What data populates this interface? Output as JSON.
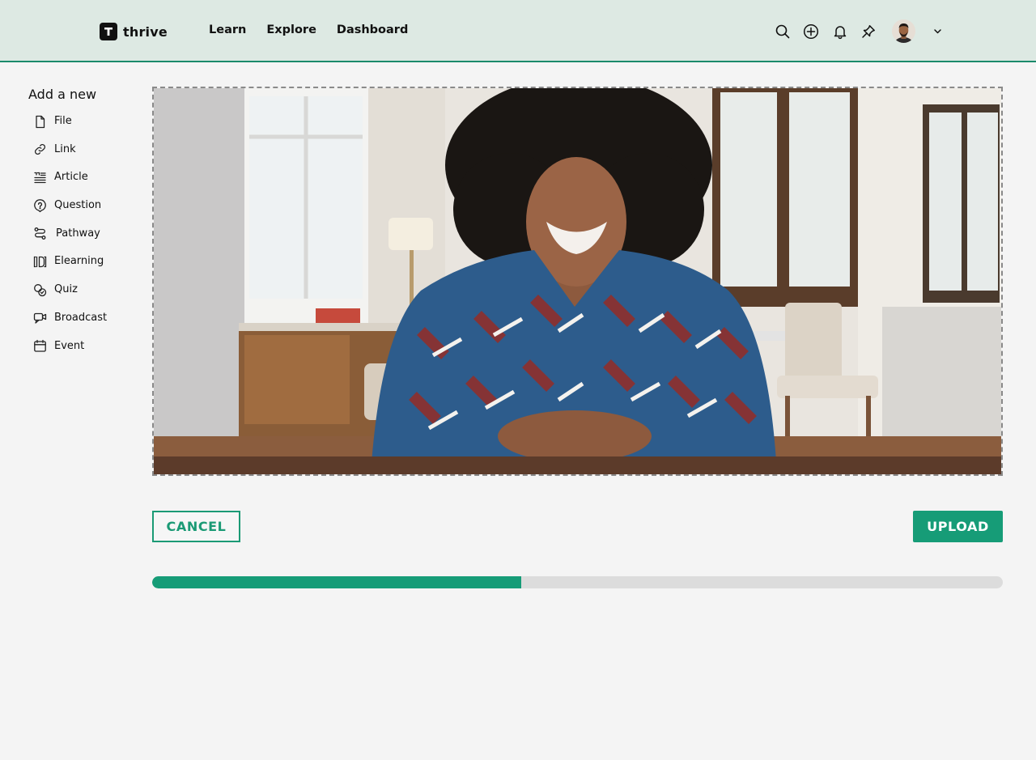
{
  "header": {
    "brand": "thrive",
    "nav": [
      "Learn",
      "Explore",
      "Dashboard"
    ],
    "icons": [
      "search-icon",
      "add-circle-icon",
      "bell-icon",
      "pin-icon",
      "chevron-down-icon"
    ],
    "accent": "#1b8a6b",
    "background": "#dde9e3"
  },
  "sidebar": {
    "title": "Add a new",
    "items": [
      {
        "label": "File",
        "icon": "file-icon"
      },
      {
        "label": "Link",
        "icon": "link-icon"
      },
      {
        "label": "Article",
        "icon": "article-icon"
      },
      {
        "label": "Question",
        "icon": "question-icon"
      },
      {
        "label": "Pathway",
        "icon": "pathway-icon"
      },
      {
        "label": "Elearning",
        "icon": "elearning-icon"
      },
      {
        "label": "Quiz",
        "icon": "quiz-icon"
      },
      {
        "label": "Broadcast",
        "icon": "broadcast-icon"
      },
      {
        "label": "Event",
        "icon": "calendar-icon"
      }
    ]
  },
  "actions": {
    "cancel_label": "CANCEL",
    "upload_label": "UPLOAD",
    "brand_color": "#169c77"
  },
  "upload_progress": {
    "fraction": 0.434
  }
}
